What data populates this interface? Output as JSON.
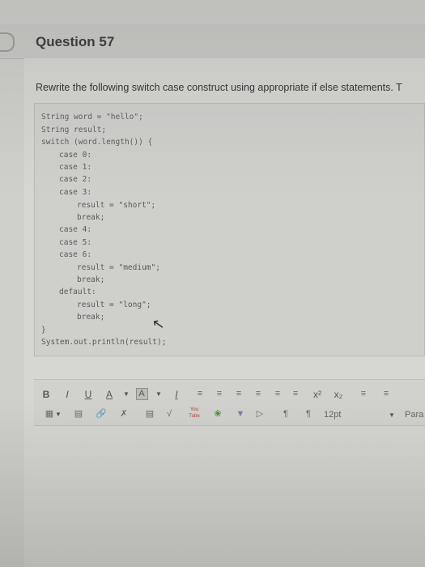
{
  "question": {
    "title": "Question 57",
    "prompt": "Rewrite the following switch case construct using appropriate if else statements. T"
  },
  "code": {
    "lines": [
      "String word = \"hello\";",
      "String result;",
      "switch (word.length()) {",
      "case 0:",
      "case 1:",
      "case 2:",
      "case 3:",
      "result = \"short\";",
      "break;",
      "case 4:",
      "case 5:",
      "case 6:",
      "result = \"medium\";",
      "break;",
      "default:",
      "result = \"long\";",
      "break;",
      "}",
      "System.out.println(result);"
    ]
  },
  "toolbar": {
    "bold": "B",
    "italic": "I",
    "underline": "U",
    "font_color": "A",
    "highlight": "A",
    "clear_format": "I",
    "superscript": "x²",
    "subscript": "x₂",
    "font_size": "12pt",
    "paragraph": "Para",
    "youtube": "You Tube"
  },
  "icons": [
    "align-left-icon",
    "align-center-icon",
    "align-right-icon",
    "justify-icon",
    "indent-icon",
    "bullet-list-icon",
    "numbered-list-icon",
    "table-icon",
    "embed-icon",
    "link-icon",
    "unlink-icon",
    "image-icon",
    "math-icon",
    "youtube-icon",
    "leaf-icon",
    "chevron-icon",
    "media-icon",
    "ltr-icon",
    "rtl-icon",
    "dropdown-icon"
  ]
}
